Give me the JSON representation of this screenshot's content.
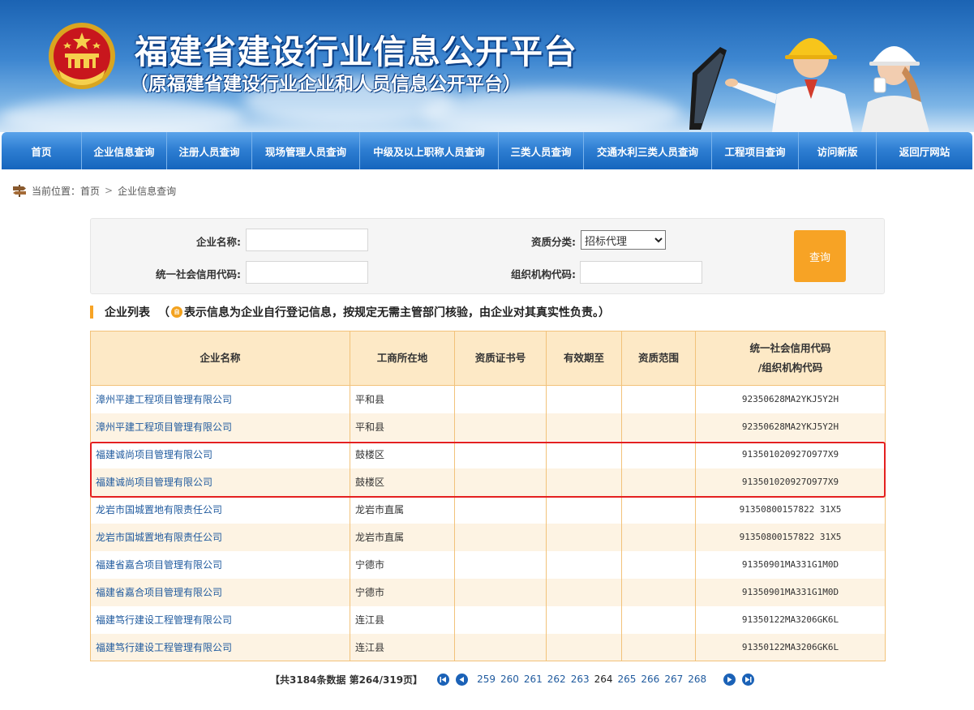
{
  "header": {
    "title": "福建省建设行业信息公开平台",
    "subtitle": "（原福建省建设行业企业和人员信息公开平台）"
  },
  "nav": {
    "items": [
      {
        "label": "首页"
      },
      {
        "label": "企业信息查询"
      },
      {
        "label": "注册人员查询"
      },
      {
        "label": "现场管理人员查询"
      },
      {
        "label": "中级及以上职称人员查询"
      },
      {
        "label": "三类人员查询"
      },
      {
        "label": "交通水利三类人员查询"
      },
      {
        "label": "工程项目查询"
      },
      {
        "label": "访问新版"
      },
      {
        "label": "返回厅网站"
      }
    ]
  },
  "breadcrumb": {
    "prefix": "当前位置：",
    "home": "首页",
    "separator": ">",
    "current": "企业信息查询"
  },
  "search": {
    "company_name_label": "企业名称:",
    "company_name_value": "",
    "credit_code_label": "统一社会信用代码:",
    "credit_code_value": "",
    "qualification_label": "资质分类:",
    "qualification_value": "招标代理",
    "org_code_label": "组织机构代码:",
    "org_code_value": "",
    "query_button": "查询"
  },
  "list": {
    "title": "企业列表",
    "notice_open": "（",
    "notice_icon": "self-registered-icon",
    "notice_text": "表示信息为企业自行登记信息，按规定无需主管部门核验，由企业对其真实性负责。）"
  },
  "table": {
    "headers": {
      "name": "企业名称",
      "location": "工商所在地",
      "cert_no": "资质证书号",
      "valid_until": "有效期至",
      "scope": "资质范围",
      "code_line1": "统一社会信用代码",
      "code_line2": "/组织机构代码"
    },
    "rows": [
      {
        "name": "漳州平建工程项目管理有限公司",
        "location": "平和县",
        "cert_no": "",
        "valid_until": "",
        "scope": "",
        "code": "92350628MA2YKJ5Y2H"
      },
      {
        "name": "漳州平建工程项目管理有限公司",
        "location": "平和县",
        "cert_no": "",
        "valid_until": "",
        "scope": "",
        "code": "92350628MA2YKJ5Y2H"
      },
      {
        "name": "福建诚尚项目管理有限公司",
        "location": "鼓楼区",
        "cert_no": "",
        "valid_until": "",
        "scope": "",
        "code": "913501020927O977X9"
      },
      {
        "name": "福建诚尚项目管理有限公司",
        "location": "鼓楼区",
        "cert_no": "",
        "valid_until": "",
        "scope": "",
        "code": "913501020927O977X9"
      },
      {
        "name": "龙岩市国城置地有限责任公司",
        "location": "龙岩市直属",
        "cert_no": "",
        "valid_until": "",
        "scope": "",
        "code": "91350800157822 31X5"
      },
      {
        "name": "龙岩市国城置地有限责任公司",
        "location": "龙岩市直属",
        "cert_no": "",
        "valid_until": "",
        "scope": "",
        "code": "91350800157822 31X5"
      },
      {
        "name": "福建省嘉合项目管理有限公司",
        "location": "宁德市",
        "cert_no": "",
        "valid_until": "",
        "scope": "",
        "code": "91350901MA331G1M0D"
      },
      {
        "name": "福建省嘉合项目管理有限公司",
        "location": "宁德市",
        "cert_no": "",
        "valid_until": "",
        "scope": "",
        "code": "91350901MA331G1M0D"
      },
      {
        "name": "福建笃行建设工程管理有限公司",
        "location": "连江县",
        "cert_no": "",
        "valid_until": "",
        "scope": "",
        "code": "91350122MA3206GK6L"
      },
      {
        "name": "福建笃行建设工程管理有限公司",
        "location": "连江县",
        "cert_no": "",
        "valid_until": "",
        "scope": "",
        "code": "91350122MA3206GK6L"
      }
    ]
  },
  "pagination": {
    "summary": "【共3184条数据 第264/319页】",
    "pages": [
      "259",
      "260",
      "261",
      "262",
      "263",
      "264",
      "265",
      "266",
      "267",
      "268"
    ],
    "current": "264"
  },
  "colors": {
    "nav_blue": "#2f7fd3",
    "accent_orange": "#f7a325",
    "table_header_bg": "#fde9c6",
    "link_blue": "#1f5a9e",
    "highlight_red": "#e42020"
  }
}
